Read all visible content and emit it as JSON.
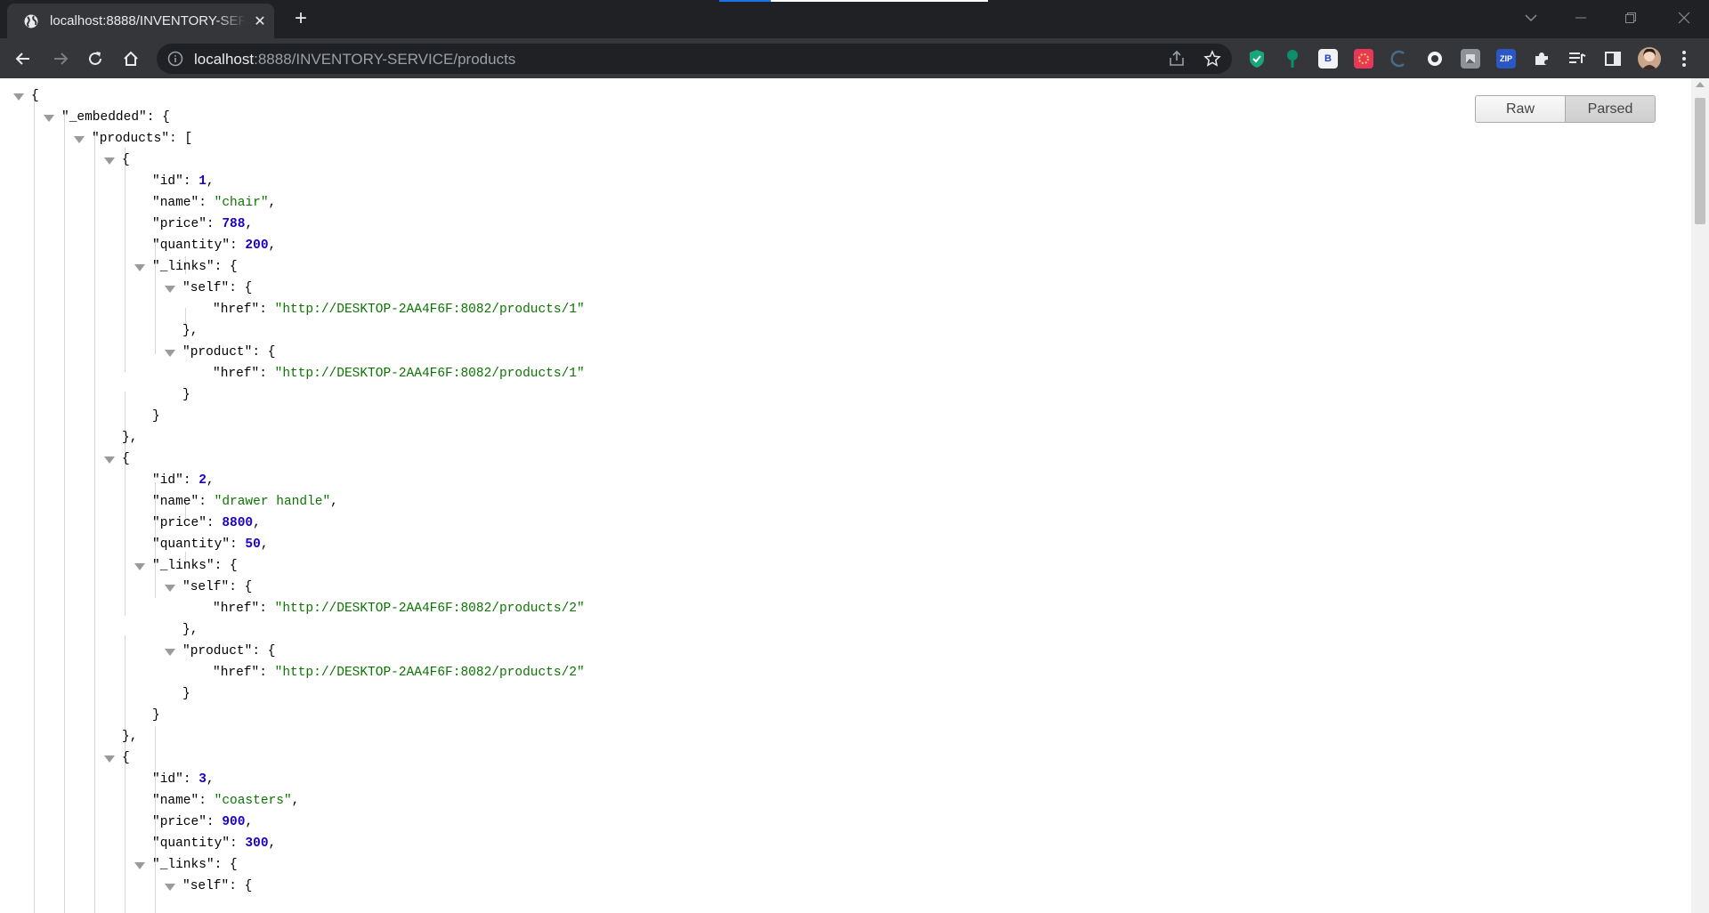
{
  "browser": {
    "tab_title": "localhost:8888/INVENTORY-SERVICE/products",
    "url_host": "localhost",
    "url_rest": ":8888/INVENTORY-SERVICE/products",
    "new_tab_symbol": "+",
    "close_symbol": "✕"
  },
  "view_buttons": {
    "raw": "Raw",
    "parsed": "Parsed",
    "selected": "Parsed"
  },
  "products": [
    {
      "id": "1",
      "name": "\"chair\"",
      "price": "788",
      "quantity": "200",
      "self_href": "\"http://DESKTOP-2AA4F6F:8082/products/1\"",
      "product_href": "\"http://DESKTOP-2AA4F6F:8082/products/1\""
    },
    {
      "id": "2",
      "name": "\"drawer handle\"",
      "price": "8800",
      "quantity": "50",
      "self_href": "\"http://DESKTOP-2AA4F6F:8082/products/2\"",
      "product_href": "\"http://DESKTOP-2AA4F6F:8082/products/2\""
    },
    {
      "id": "3",
      "name": "\"coasters\"",
      "price": "900",
      "quantity": "300"
    }
  ],
  "keys": {
    "embedded": "\"_embedded\"",
    "products": "\"products\"",
    "id": "\"id\"",
    "name": "\"name\"",
    "price": "\"price\"",
    "quantity": "\"quantity\"",
    "links": "\"_links\"",
    "self": "\"self\"",
    "product": "\"product\"",
    "href": "\"href\""
  },
  "colors": {
    "string": "#0b7500",
    "number": "#1a01cc",
    "chrome_dark": "#202124",
    "chrome_toolbar": "#35363a"
  }
}
